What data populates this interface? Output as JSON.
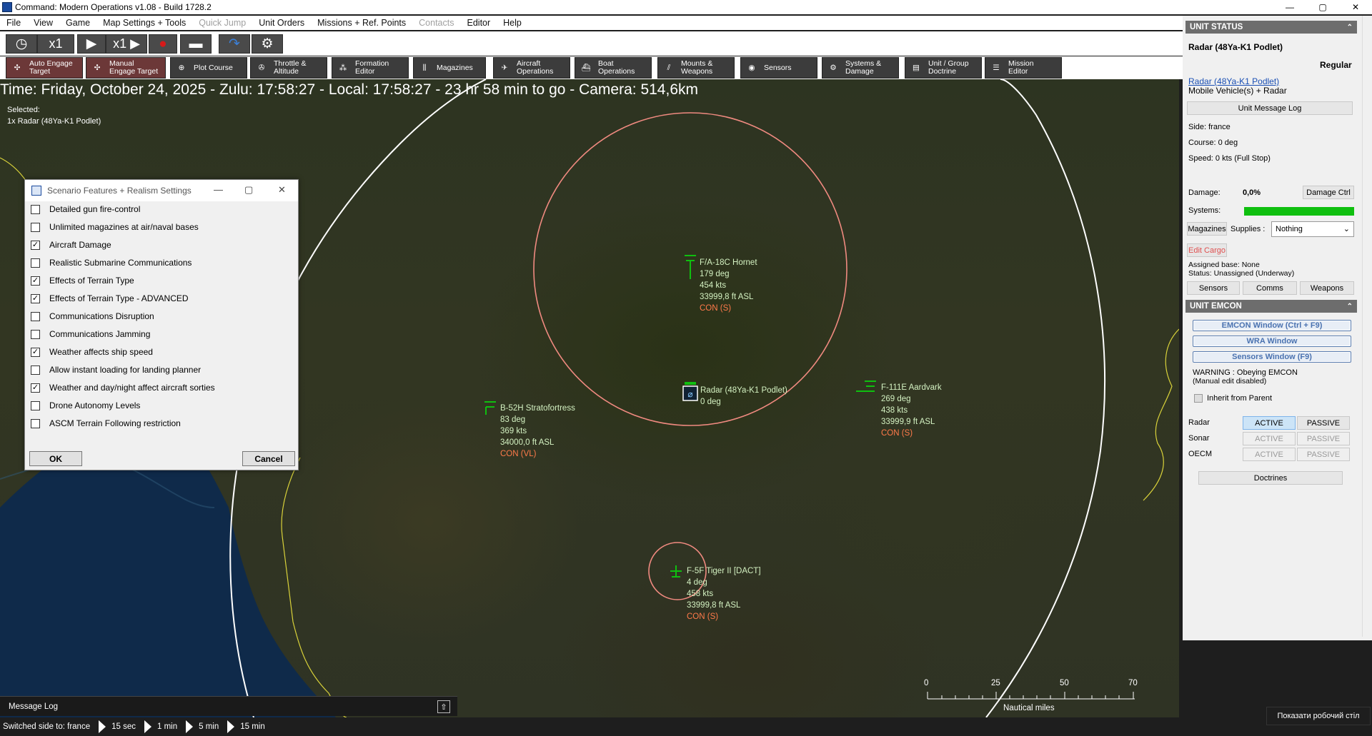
{
  "window": {
    "title": "Command: Modern Operations v1.08 - Build 1728.2",
    "buttons": {
      "min": "—",
      "max": "▢",
      "close": "✕"
    }
  },
  "menu": {
    "items": [
      "File",
      "View",
      "Game",
      "Map Settings + Tools",
      "Quick Jump",
      "Unit Orders",
      "Missions + Ref. Points",
      "Contacts",
      "Editor",
      "Help"
    ],
    "disabled": [
      "Quick Jump",
      "Contacts"
    ]
  },
  "toolbar1": {
    "speed1": "x1",
    "speed2": "x1"
  },
  "toolbar2": {
    "auto_engage": [
      "Auto Engage",
      "Target"
    ],
    "manual_engage": [
      "Manual",
      "Engage Target"
    ],
    "plot_course": "Plot Course",
    "throttle": [
      "Throttle &",
      "Altitude"
    ],
    "formation": [
      "Formation",
      "Editor"
    ],
    "magazines": "Magazines",
    "aircraft_ops": [
      "Aircraft",
      "Operations"
    ],
    "boat_ops": [
      "Boat",
      "Operations"
    ],
    "mounts": [
      "Mounts &",
      "Weapons"
    ],
    "sensors": "Sensors",
    "systems": [
      "Systems &",
      "Damage"
    ],
    "doctrine": [
      "Unit / Group",
      "Doctrine"
    ],
    "mission_editor": [
      "Mission",
      "Editor"
    ]
  },
  "map": {
    "time_line": "Time: Friday, October 24, 2025 - Zulu: 17:58:27 - Local: 17:58:27 - 23 hr 58 min to go - Camera: 514,6km",
    "selected_label": "Selected:",
    "selected_value": "1x Radar (48Ya-K1 Podlet)",
    "units": {
      "fa18": {
        "name": "F/A-18C Hornet",
        "course": "179 deg",
        "speed": "454 kts",
        "alt": "33999,8 ft ASL",
        "status": "CON (S)"
      },
      "radar": {
        "name": "Radar (48Ya-K1 Podlet)",
        "course": "0 deg"
      },
      "f111": {
        "name": "F-111E Aardvark",
        "course": "269 deg",
        "speed": "438 kts",
        "alt": "33999,9 ft ASL",
        "status": "CON (S)"
      },
      "b52": {
        "name": "B-52H Stratofortress",
        "course": "83 deg",
        "speed": "369 kts",
        "alt": "34000,0 ft ASL",
        "status": "CON (VL)"
      },
      "f5": {
        "name": "F-5F Tiger II [DACT]",
        "course": "4 deg",
        "speed": "458 kts",
        "alt": "33999,8 ft ASL",
        "status": "CON (S)"
      }
    },
    "scale": {
      "ticks": [
        "0",
        "25",
        "50",
        "70"
      ],
      "unit": "Nautical miles"
    }
  },
  "dialog": {
    "title": "Scenario Features + Realism Settings",
    "options": [
      {
        "label": "Detailed gun fire-control",
        "checked": false
      },
      {
        "label": "Unlimited magazines at air/naval bases",
        "checked": false
      },
      {
        "label": "Aircraft Damage",
        "checked": true
      },
      {
        "label": "Realistic Submarine Communications",
        "checked": false
      },
      {
        "label": "Effects of Terrain Type",
        "checked": true
      },
      {
        "label": "Effects of Terrain Type - ADVANCED",
        "checked": true
      },
      {
        "label": "Communications Disruption",
        "checked": false
      },
      {
        "label": "Communications Jamming",
        "checked": false
      },
      {
        "label": "Weather affects ship speed",
        "checked": true
      },
      {
        "label": "Allow instant loading for landing planner",
        "checked": false
      },
      {
        "label": "Weather and day/night affect aircraft sorties",
        "checked": true
      },
      {
        "label": "Drone Autonomy Levels",
        "checked": false
      },
      {
        "label": "ASCM Terrain Following restriction",
        "checked": false
      }
    ],
    "ok": "OK",
    "cancel": "Cancel"
  },
  "message_log": {
    "label": "Message Log"
  },
  "statusbar": {
    "text": "Switched side to: france",
    "steps": [
      "15 sec",
      "1 min",
      "5 min",
      "15 min"
    ]
  },
  "taskbar_button": "Показати робочий стіл",
  "unit_status": {
    "header": "UNIT STATUS",
    "name": "Radar (48Ya-K1 Podlet)",
    "proficiency": "Regular",
    "link": "Radar (48Ya-K1 Podlet)",
    "type": "Mobile Vehicle(s) + Radar",
    "msg_log_btn": "Unit Message Log",
    "side": "Side: france",
    "course": "Course: 0 deg",
    "speed": "Speed: 0 kts (Full Stop)",
    "damage_label": "Damage:",
    "damage_value": "0,0%",
    "damage_btn": "Damage Ctrl",
    "systems_label": "Systems:",
    "systems_level": 1.0,
    "magazines_btn": "Magazines",
    "supplies_label": "Supplies :",
    "supplies_value": "Nothing",
    "edit_cargo": "Edit Cargo",
    "assigned_base": "Assigned base: None",
    "status": "Status: Unassigned (Underway)",
    "tabs": [
      "Sensors",
      "Comms",
      "Weapons"
    ]
  },
  "emcon": {
    "header": "UNIT EMCON",
    "btn1": "EMCON Window (Ctrl + F9)",
    "btn2": "WRA Window",
    "btn3": "Sensors Window (F9)",
    "warning1": "WARNING : Obeying EMCON",
    "warning2": "(Manual edit disabled)",
    "inherit": "Inherit from Parent",
    "rows": [
      {
        "label": "Radar",
        "active": "ACTIVE",
        "passive": "PASSIVE"
      },
      {
        "label": "Sonar",
        "active": "ACTIVE",
        "passive": "PASSIVE"
      },
      {
        "label": "OECM",
        "active": "ACTIVE",
        "passive": "PASSIVE"
      }
    ],
    "doctrines": "Doctrines"
  },
  "colors": {
    "accent_green": "#0fbf0f",
    "contact_red": "#ff7a4a",
    "unit_green": "#d3f1c1",
    "range_ring": "#f08a80",
    "coast": "#d9d23a"
  }
}
